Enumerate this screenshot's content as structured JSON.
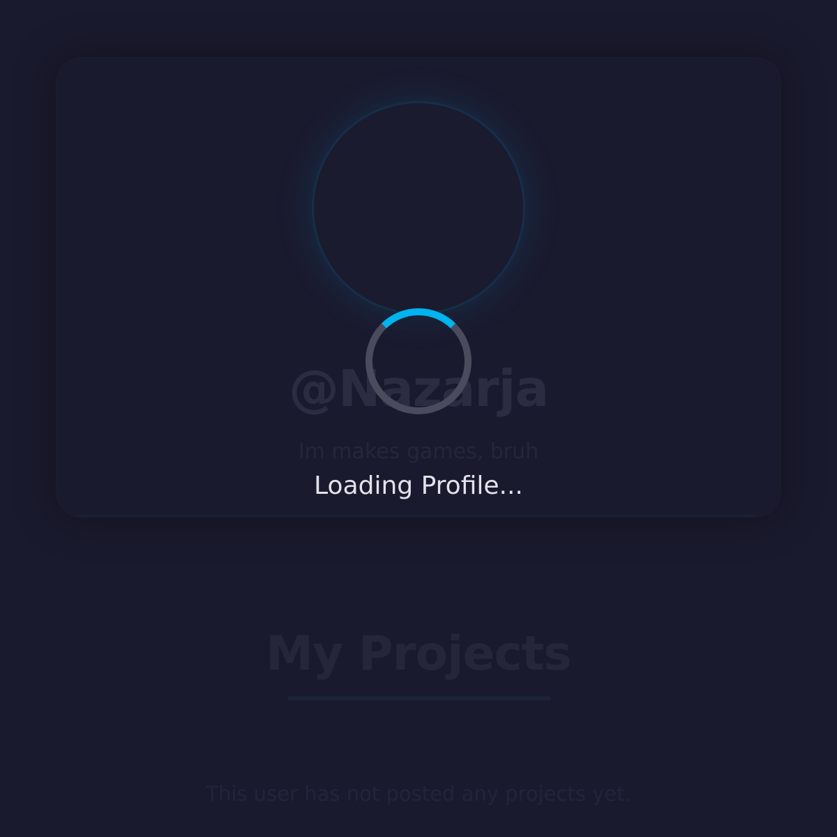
{
  "profile": {
    "username": "@Nazarja",
    "bio": "Im makes games, bruh"
  },
  "projects": {
    "heading": "My Projects",
    "empty_message": "This user has not posted any projects yet."
  },
  "loading": {
    "text": "Loading Profile...",
    "accent_color": "#00b4f0",
    "track_color": "#4a4b5c"
  },
  "colors": {
    "background": "#1a1a2e"
  }
}
